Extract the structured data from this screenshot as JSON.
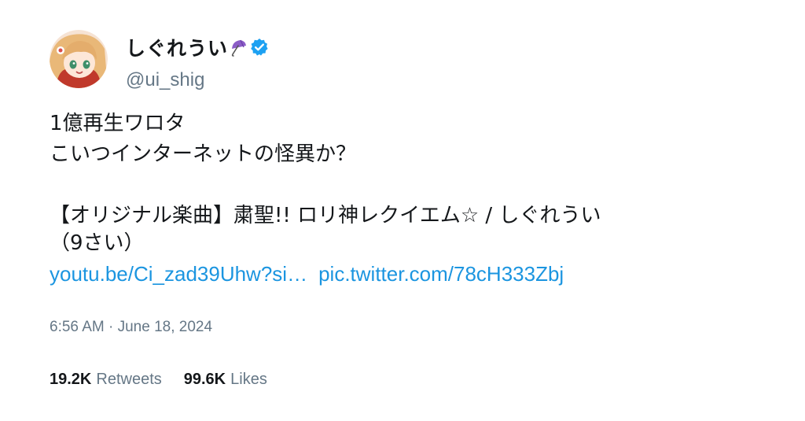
{
  "user": {
    "display_name": "しぐれうい",
    "name_emoji_icon": "umbrella-icon",
    "verified_icon": "verified-badge-icon",
    "handle": "@ui_shig"
  },
  "tweet": {
    "line1": "1億再生ワロタ",
    "line2": "こいつインターネットの怪異か？",
    "song_line1": "【オリジナル楽曲】粛聖!! ロリ神レクイエム☆ / しぐれうい",
    "song_line2": "（9さい）",
    "link_youtube": "youtu.be/Ci_zad39Uhw?si…",
    "link_pic": "pic.twitter.com/78cH333Zbj"
  },
  "meta": {
    "timestamp": "6:56 AM · June 18, 2024"
  },
  "stats": {
    "retweets_count": "19.2K",
    "retweets_label": "Retweets",
    "likes_count": "99.6K",
    "likes_label": "Likes"
  },
  "colors": {
    "text": "#14171a",
    "muted": "#657786",
    "link": "#1b95e0",
    "verified": "#1da1f2"
  }
}
